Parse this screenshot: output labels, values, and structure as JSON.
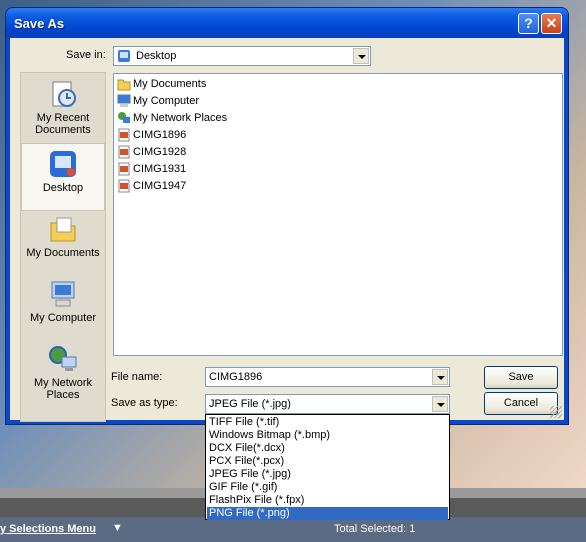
{
  "dialog": {
    "title": "Save As",
    "save_in_label": "Save in:",
    "save_in_value": "Desktop",
    "file_name_label": "File name:",
    "file_name_value": "CIMG1896",
    "save_as_type_label": "Save as type:",
    "save_as_type_value": "JPEG File (*.jpg)",
    "save_button": "Save",
    "cancel_button": "Cancel",
    "help_glyph": "?",
    "close_glyph": "✕",
    "toolbar": {
      "back": "←",
      "up": "📁",
      "new_folder": "✱",
      "views": "▦▾"
    }
  },
  "places": [
    {
      "label": "My Recent Documents",
      "icon": "recent-documents-icon"
    },
    {
      "label": "Desktop",
      "icon": "desktop-icon",
      "selected": true
    },
    {
      "label": "My Documents",
      "icon": "my-documents-icon"
    },
    {
      "label": "My Computer",
      "icon": "my-computer-icon"
    },
    {
      "label": "My Network Places",
      "icon": "network-places-icon"
    }
  ],
  "files": [
    {
      "name": "My Documents",
      "icon": "folder-icon"
    },
    {
      "name": "My Computer",
      "icon": "computer-icon"
    },
    {
      "name": "My Network Places",
      "icon": "network-icon"
    },
    {
      "name": "CIMG1896",
      "icon": "image-file-icon"
    },
    {
      "name": "CIMG1928",
      "icon": "image-file-icon"
    },
    {
      "name": "CIMG1931",
      "icon": "image-file-icon"
    },
    {
      "name": "CIMG1947",
      "icon": "image-file-icon"
    }
  ],
  "type_options": [
    {
      "label": "TIFF File (*.tif)"
    },
    {
      "label": "Windows Bitmap (*.bmp)"
    },
    {
      "label": "DCX File(*.dcx)"
    },
    {
      "label": "PCX File(*.pcx)"
    },
    {
      "label": "JPEG File (*.jpg)"
    },
    {
      "label": "GIF File (*.gif)"
    },
    {
      "label": "FlashPix File (*.fpx)"
    },
    {
      "label": "PNG File (*.png)",
      "selected": true
    }
  ],
  "background": {
    "menu_link": "y Selections Menu",
    "menu_arrow": "▼",
    "total_selected": "Total Selected: 1"
  },
  "colors": {
    "title_blue": "#0a5be0",
    "selection_blue": "#316ac5",
    "dialog_face": "#ece9d8"
  }
}
